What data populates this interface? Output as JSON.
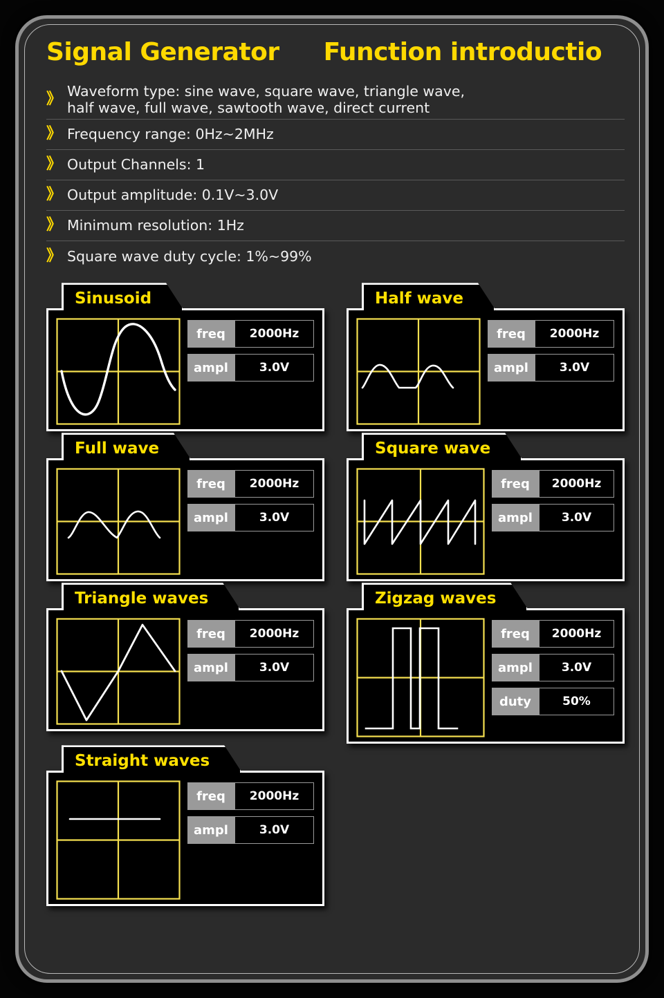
{
  "header": {
    "title": "Signal Generator",
    "subtitle": "Function introductio"
  },
  "bullet_glyph": "》",
  "colors": {
    "accent_yellow": "#ffd900",
    "trace_white": "#ffffff",
    "grid_yellow": "#f5e050",
    "label_gray": "#9a9a9a",
    "frame_gray": "#8f8f8f",
    "panel_bg": "#2b2b2b",
    "scope_bg": "#000000"
  },
  "specs": [
    {
      "text": "Waveform type: sine wave, square wave, triangle wave,\nhalf wave, full wave, sawtooth wave, direct current"
    },
    {
      "text": "Frequency range: 0Hz~2MHz"
    },
    {
      "text": "Output Channels: 1"
    },
    {
      "text": "Output amplitude: 0.1V~3.0V"
    },
    {
      "text": "Minimum resolution: 1Hz"
    },
    {
      "text": "Square wave duty cycle: 1%~99%"
    }
  ],
  "cards": [
    {
      "tab": "Sinusoid",
      "waveform": "sine",
      "readouts": [
        {
          "label": "freq",
          "value": "2000Hz"
        },
        {
          "label": "ampl",
          "value": "3.0V"
        }
      ]
    },
    {
      "tab": "Half wave",
      "waveform": "half-wave",
      "readouts": [
        {
          "label": "freq",
          "value": "2000Hz"
        },
        {
          "label": "ampl",
          "value": "3.0V"
        }
      ]
    },
    {
      "tab": "Full wave",
      "waveform": "full-wave",
      "readouts": [
        {
          "label": "freq",
          "value": "2000Hz"
        },
        {
          "label": "ampl",
          "value": "3.0V"
        }
      ]
    },
    {
      "tab": "Square wave",
      "waveform": "sawtooth",
      "readouts": [
        {
          "label": "freq",
          "value": "2000Hz"
        },
        {
          "label": "ampl",
          "value": "3.0V"
        }
      ]
    },
    {
      "tab": "Triangle waves",
      "waveform": "triangle",
      "readouts": [
        {
          "label": "freq",
          "value": "2000Hz"
        },
        {
          "label": "ampl",
          "value": "3.0V"
        }
      ]
    },
    {
      "tab": "Zigzag waves",
      "waveform": "square-pulse",
      "readouts": [
        {
          "label": "freq",
          "value": "2000Hz"
        },
        {
          "label": "ampl",
          "value": "3.0V"
        },
        {
          "label": "duty",
          "value": "50%"
        }
      ]
    },
    {
      "tab": "Straight waves",
      "waveform": "dc-line",
      "readouts": [
        {
          "label": "freq",
          "value": "2000Hz"
        },
        {
          "label": "ampl",
          "value": "3.0V"
        }
      ]
    }
  ]
}
